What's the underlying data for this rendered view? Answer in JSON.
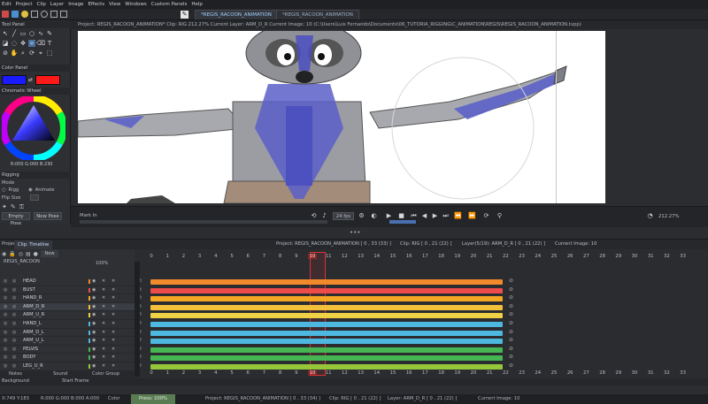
{
  "menubar": [
    "Edit",
    "Project",
    "Clip",
    "Layer",
    "Image",
    "Effects",
    "View",
    "Windows",
    "Custom Panels",
    "Help"
  ],
  "tabs": [
    {
      "label": "*REGIS_RACOON_ANIMATION"
    },
    {
      "label": "*REGIS_RACOON_ANIMATION"
    }
  ],
  "info": {
    "project": "Project: REGIS_RACOON_ANIMATION*  Clip: RIG  212.27%  Current Layer: ARM_D_R  Current Image: 10 (C:\\Users\\Luis Fernando\\Documents\\06_TUTORIA_RIGGING\\C_ANIMATION\\REGIS\\REGIS_RACOON_ANIMATION.tvpp)"
  },
  "left": {
    "tool_panel_title": "Tool Panel",
    "color_panel_title": "Color Panel",
    "wheel_title": "Chromatic Wheel",
    "rgb_readout": "R:000 G:000 B:230",
    "rigging_title": "Rigging",
    "mode_label": "Mode",
    "rigg_label": "Rigg",
    "animate_label": "Animate",
    "flip_size_label": "Flip Size",
    "empty_pose": "Empty Pose",
    "new_pose": "New Pose",
    "colors": {
      "primary": "#1a1aff",
      "secondary": "#ff1a1a"
    }
  },
  "playbar": {
    "mark_in": "Mark In",
    "fps": "24 fps",
    "zoom": "212.27%"
  },
  "timeline": {
    "tab_project": "Project",
    "tab_clip": "Clip: Timeline",
    "header_info": "Project: REGIS_RACOON_ANIMATION [ 0 , 33 (33) ]",
    "clip_info": "Clip: RIG [ 0 , 21 (22) ]",
    "layer_info": "Layer(5/19): ARM_D_R [ 0 , 21 (22) ]",
    "current_image": "Current Image: 10",
    "clip_name": "REGIS_RACOON",
    "new_label": "New",
    "opacity": "100%",
    "frames_top": [
      "0",
      "1",
      "2",
      "3",
      "4",
      "5",
      "6",
      "7",
      "8",
      "9",
      "10",
      "11",
      "12",
      "13",
      "14",
      "15",
      "16",
      "17",
      "18",
      "19",
      "20",
      "21",
      "22",
      "23",
      "24",
      "25",
      "26",
      "27",
      "28",
      "29",
      "30",
      "31",
      "32",
      "33"
    ],
    "frames_bottom": [
      "0",
      "1",
      "2",
      "3",
      "4",
      "5",
      "6",
      "7",
      "8",
      "9",
      "10",
      "11",
      "12",
      "13",
      "14",
      "15",
      "16",
      "17",
      "18",
      "19",
      "20",
      "21",
      "22",
      "23",
      "24",
      "25",
      "26",
      "27",
      "28",
      "29",
      "30",
      "31",
      "32",
      "33"
    ],
    "layers": [
      {
        "name": "HEAD",
        "color": "#f08a2a"
      },
      {
        "name": "BUST",
        "color": "#ef4b4b"
      },
      {
        "name": "HAND_R",
        "color": "#f5a623"
      },
      {
        "name": "ARM_D_R",
        "color": "#f3c03a"
      },
      {
        "name": "ARM_U_R",
        "color": "#f0d044"
      },
      {
        "name": "HAND_L",
        "color": "#4db8e0"
      },
      {
        "name": "ARM_D_L",
        "color": "#4db8e0"
      },
      {
        "name": "ARM_U_L",
        "color": "#4db8e0"
      },
      {
        "name": "PELVIS",
        "color": "#45b651"
      },
      {
        "name": "BODY",
        "color": "#45b651"
      },
      {
        "name": "LEG_U_R",
        "color": "#96c63a"
      }
    ],
    "bottom_tabs": [
      "Notes",
      "Sound",
      "Color Group"
    ],
    "background_label": "Background",
    "start_frame_label": "Start Frame"
  },
  "status": {
    "coords": "X:749  Y:183",
    "rgba": "R:000 G:000 B:000 A:000",
    "color_label": "Color",
    "pressure_label": "Press: 100%",
    "project": "Project: REGIS_RACOON_ANIMATION [ 0 , 33 (34) ]",
    "clip": "Clip: RIG [ 0 , 21 (22) ]",
    "layer": "Layer: ARM_D_R [ 0 , 21 (22) ]",
    "current_image": "Current Image: 10"
  }
}
